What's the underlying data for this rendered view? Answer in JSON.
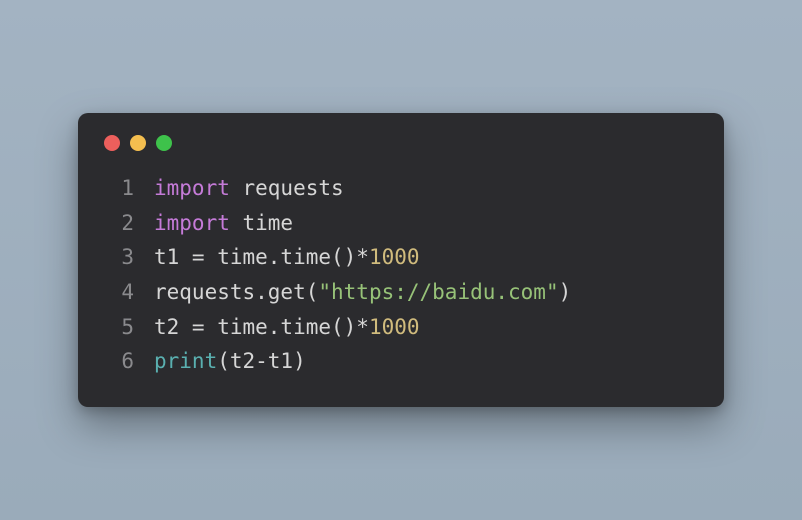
{
  "window": {
    "dots": [
      "red",
      "yellow",
      "green"
    ]
  },
  "code": {
    "lines": [
      {
        "num": "1",
        "tokens": [
          {
            "t": "import",
            "c": "keyword"
          },
          {
            "t": " requests",
            "c": "default"
          }
        ]
      },
      {
        "num": "2",
        "tokens": [
          {
            "t": "import",
            "c": "keyword"
          },
          {
            "t": " time",
            "c": "default"
          }
        ]
      },
      {
        "num": "3",
        "tokens": [
          {
            "t": "t1 = time.time()*",
            "c": "default"
          },
          {
            "t": "1000",
            "c": "number"
          }
        ]
      },
      {
        "num": "4",
        "tokens": [
          {
            "t": "requests.get(",
            "c": "default"
          },
          {
            "t": "\"https://baidu.com\"",
            "c": "string"
          },
          {
            "t": ")",
            "c": "default"
          }
        ]
      },
      {
        "num": "5",
        "tokens": [
          {
            "t": "t2 = time.time()*",
            "c": "default"
          },
          {
            "t": "1000",
            "c": "number"
          }
        ]
      },
      {
        "num": "6",
        "tokens": [
          {
            "t": "print",
            "c": "builtin"
          },
          {
            "t": "(t2-t1)",
            "c": "default"
          }
        ]
      }
    ]
  }
}
